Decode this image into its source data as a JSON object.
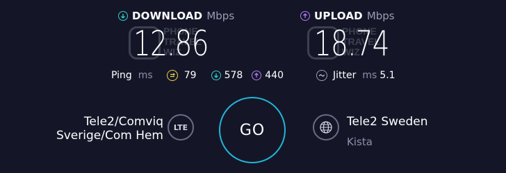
{
  "download": {
    "label": "DOWNLOAD",
    "unit": "Mbps",
    "value": "12.86"
  },
  "upload": {
    "label": "UPLOAD",
    "unit": "Mbps",
    "value": "18.74"
  },
  "watermark": {
    "line1": "PHONE",
    "line2": "TRAVEL",
    "line3": "WIZ"
  },
  "ping": {
    "label": "Ping",
    "unit": "ms",
    "idle": "79",
    "download": "578",
    "upload": "440"
  },
  "jitter": {
    "label": "Jitter",
    "unit": "ms",
    "value": "5.1"
  },
  "go_label": "GO",
  "provider": {
    "line1": "Tele2/Comviq",
    "line2": "Sverige/Com Hem",
    "tech": "LTE"
  },
  "server": {
    "name": "Tele2 Sweden",
    "location": "Kista"
  },
  "colors": {
    "background": "#141628",
    "download_accent": "#2fd1c6",
    "upload_accent": "#b37cf0",
    "idle_accent": "#f2d24a",
    "go_ring": "#22b6d7"
  }
}
